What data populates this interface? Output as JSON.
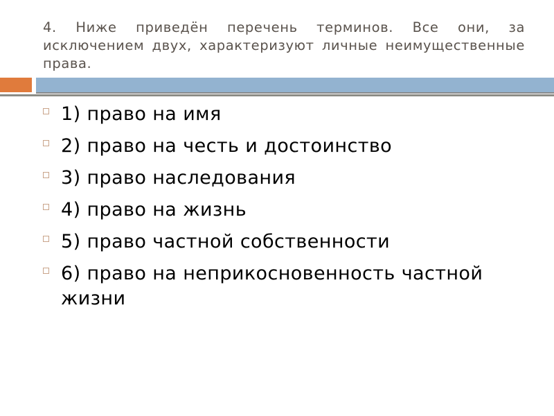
{
  "slide": {
    "title": "4. Ниже приведён перечень терминов. Все они, за исключением двух, характеризуют личные неимущественные права.",
    "accent_colors": {
      "orange_bar": "#e07b3c",
      "blue_bar": "#93b3d0",
      "rule": "#8a8a8a",
      "bullet_border": "#c9a48a",
      "title_text": "#5a534d"
    },
    "bullet_icon": "hollow-square",
    "items": [
      {
        "label": "1) право на имя"
      },
      {
        "label": "2) право на честь и достоинство"
      },
      {
        "label": "3) право наследования"
      },
      {
        "label": "4) право на жизнь"
      },
      {
        "label": "5) право частной собственности"
      },
      {
        "label": "6) право на неприкосновенность частной жизни"
      }
    ]
  }
}
